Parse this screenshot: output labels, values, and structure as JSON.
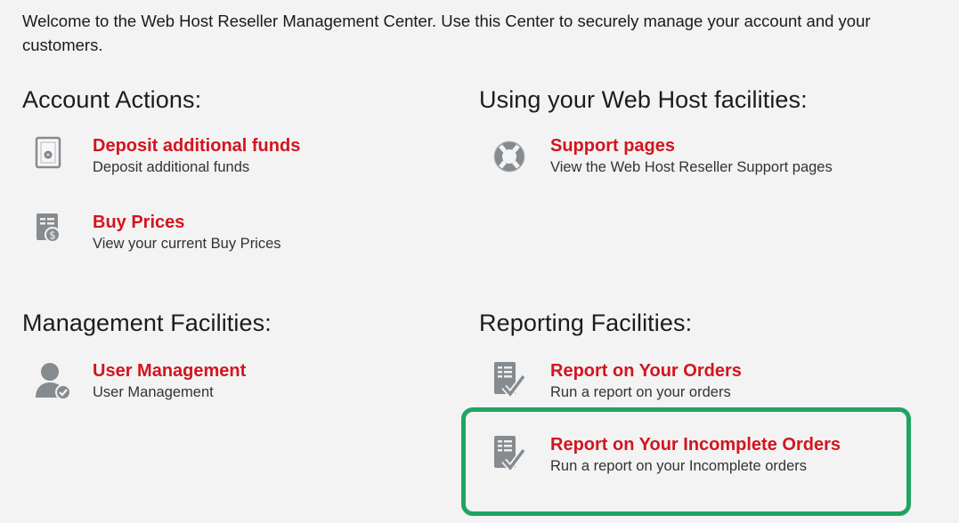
{
  "welcome": "Welcome to the Web Host Reseller Management Center. Use this Center to securely manage your account and your customers.",
  "sections": {
    "account": {
      "title": "Account Actions:",
      "items": [
        {
          "label": "Deposit additional funds",
          "desc": "Deposit additional funds",
          "icon": "safe-icon"
        },
        {
          "label": "Buy Prices",
          "desc": "View your current Buy Prices",
          "icon": "price-list-icon"
        }
      ]
    },
    "webhost": {
      "title": "Using your Web Host facilities:",
      "items": [
        {
          "label": "Support pages",
          "desc": "View the Web Host Reseller Support pages",
          "icon": "lifebuoy-icon"
        }
      ]
    },
    "management": {
      "title": "Management Facilities:",
      "items": [
        {
          "label": "User Management",
          "desc": "User Management",
          "icon": "user-check-icon"
        }
      ]
    },
    "reporting": {
      "title": "Reporting Facilities:",
      "items": [
        {
          "label": "Report on Your Orders",
          "desc": "Run a report on your orders",
          "icon": "report-check-icon"
        },
        {
          "label": "Report on Your Incomplete Orders",
          "desc": "Run a report on your Incomplete orders",
          "icon": "report-check-icon"
        }
      ]
    }
  },
  "colors": {
    "link": "#d2151e",
    "highlight": "#1fa463",
    "icon": "#8a8f94",
    "background": "#f3f3f3"
  }
}
